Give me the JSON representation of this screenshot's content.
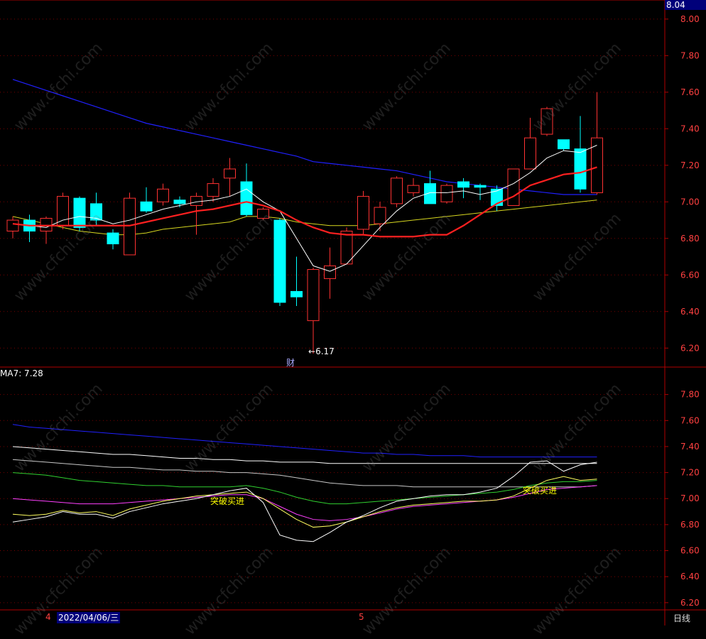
{
  "chart_data": [
    {
      "type": "candlestick",
      "panel": "main",
      "ylim": [
        6.1,
        8.05
      ],
      "yticks": [
        "8.00",
        "7.80",
        "7.60",
        "7.40",
        "7.20",
        "7.00",
        "6.80",
        "6.60",
        "6.40",
        "6.20"
      ],
      "current_price_label": "8.04",
      "low_annotation": "6.17",
      "event_marker": "财",
      "colors": {
        "up": "#ff3232",
        "down": "#00ffff",
        "ma_white": "#ffffff",
        "ma_red": "#ff2020",
        "ma_yellow": "#d8d820",
        "ma_blue": "#2020ff"
      },
      "candles": [
        {
          "o": 6.84,
          "h": 6.92,
          "l": 6.8,
          "c": 6.9
        },
        {
          "o": 6.9,
          "h": 6.93,
          "l": 6.78,
          "c": 6.84
        },
        {
          "o": 6.84,
          "h": 6.92,
          "l": 6.77,
          "c": 6.91
        },
        {
          "o": 6.87,
          "h": 7.05,
          "l": 6.85,
          "c": 7.03
        },
        {
          "o": 7.02,
          "h": 7.03,
          "l": 6.84,
          "c": 6.86
        },
        {
          "o": 6.99,
          "h": 7.05,
          "l": 6.87,
          "c": 6.9
        },
        {
          "o": 6.83,
          "h": 6.85,
          "l": 6.74,
          "c": 6.77
        },
        {
          "o": 6.71,
          "h": 7.05,
          "l": 6.71,
          "c": 7.02
        },
        {
          "o": 7.0,
          "h": 7.08,
          "l": 6.94,
          "c": 6.95
        },
        {
          "o": 7.0,
          "h": 7.1,
          "l": 6.98,
          "c": 7.07
        },
        {
          "o": 7.01,
          "h": 7.03,
          "l": 6.97,
          "c": 6.99
        },
        {
          "o": 6.98,
          "h": 7.05,
          "l": 6.82,
          "c": 7.03
        },
        {
          "o": 7.03,
          "h": 7.13,
          "l": 7.0,
          "c": 7.1
        },
        {
          "o": 7.13,
          "h": 7.24,
          "l": 7.03,
          "c": 7.18
        },
        {
          "o": 7.11,
          "h": 7.21,
          "l": 6.92,
          "c": 6.93
        },
        {
          "o": 6.91,
          "h": 6.97,
          "l": 6.9,
          "c": 6.96
        },
        {
          "o": 6.9,
          "h": 6.91,
          "l": 6.43,
          "c": 6.45
        },
        {
          "o": 6.51,
          "h": 6.7,
          "l": 6.43,
          "c": 6.48
        },
        {
          "o": 6.35,
          "h": 6.64,
          "l": 6.17,
          "c": 6.63
        },
        {
          "o": 6.58,
          "h": 6.75,
          "l": 6.47,
          "c": 6.65
        },
        {
          "o": 6.66,
          "h": 6.86,
          "l": 6.66,
          "c": 6.84
        },
        {
          "o": 6.85,
          "h": 7.06,
          "l": 6.82,
          "c": 7.03
        },
        {
          "o": 6.88,
          "h": 7.0,
          "l": 6.84,
          "c": 6.97
        },
        {
          "o": 6.99,
          "h": 7.14,
          "l": 6.97,
          "c": 7.13
        },
        {
          "o": 7.05,
          "h": 7.13,
          "l": 7.03,
          "c": 7.09
        },
        {
          "o": 7.1,
          "h": 7.17,
          "l": 6.99,
          "c": 6.99
        },
        {
          "o": 7.0,
          "h": 7.1,
          "l": 6.99,
          "c": 7.09
        },
        {
          "o": 7.11,
          "h": 7.13,
          "l": 7.02,
          "c": 7.08
        },
        {
          "o": 7.09,
          "h": 7.1,
          "l": 7.01,
          "c": 7.08
        },
        {
          "o": 7.07,
          "h": 7.09,
          "l": 6.95,
          "c": 6.98
        },
        {
          "o": 6.98,
          "h": 7.18,
          "l": 6.98,
          "c": 7.18
        },
        {
          "o": 7.18,
          "h": 7.46,
          "l": 7.18,
          "c": 7.35
        },
        {
          "o": 7.37,
          "h": 7.52,
          "l": 7.36,
          "c": 7.51
        },
        {
          "o": 7.34,
          "h": 7.34,
          "l": 7.28,
          "c": 7.29
        },
        {
          "o": 7.29,
          "h": 7.47,
          "l": 7.05,
          "c": 7.07
        },
        {
          "o": 7.05,
          "h": 7.6,
          "l": 7.04,
          "c": 7.35
        }
      ],
      "ma_white": [
        6.88,
        6.87,
        6.86,
        6.9,
        6.92,
        6.91,
        6.88,
        6.9,
        6.93,
        6.96,
        6.98,
        7.0,
        7.01,
        7.03,
        7.07,
        7.0,
        6.95,
        6.8,
        6.65,
        6.62,
        6.66,
        6.76,
        6.86,
        6.95,
        7.02,
        7.05,
        7.05,
        7.06,
        7.04,
        7.06,
        7.1,
        7.16,
        7.24,
        7.28,
        7.27,
        7.31
      ],
      "ma_red": [
        6.88,
        6.87,
        6.87,
        6.87,
        6.87,
        6.87,
        6.87,
        6.87,
        6.89,
        6.91,
        6.93,
        6.95,
        6.96,
        6.98,
        7.0,
        6.98,
        6.95,
        6.9,
        6.86,
        6.83,
        6.82,
        6.82,
        6.81,
        6.81,
        6.81,
        6.82,
        6.82,
        6.87,
        6.93,
        6.99,
        7.03,
        7.09,
        7.12,
        7.15,
        7.16,
        7.19
      ],
      "ma_yellow": [
        6.92,
        6.9,
        6.88,
        6.86,
        6.84,
        6.83,
        6.82,
        6.82,
        6.83,
        6.85,
        6.86,
        6.87,
        6.88,
        6.89,
        6.92,
        6.92,
        6.91,
        6.89,
        6.88,
        6.87,
        6.87,
        6.87,
        6.88,
        6.89,
        6.9,
        6.91,
        6.92,
        6.93,
        6.94,
        6.95,
        6.96,
        6.97,
        6.98,
        6.99,
        7.0,
        7.01
      ],
      "ma_blue": [
        7.67,
        7.64,
        7.61,
        7.58,
        7.55,
        7.52,
        7.49,
        7.46,
        7.43,
        7.41,
        7.39,
        7.37,
        7.35,
        7.33,
        7.31,
        7.29,
        7.27,
        7.25,
        7.22,
        7.21,
        7.2,
        7.19,
        7.18,
        7.17,
        7.15,
        7.13,
        7.11,
        7.1,
        7.09,
        7.08,
        7.07,
        7.06,
        7.05,
        7.04,
        7.04,
        7.04
      ]
    },
    {
      "type": "line",
      "panel": "indicator",
      "readout": "MA7: 7.28",
      "ylim": [
        6.15,
        8.0
      ],
      "yticks": [
        "7.80",
        "7.60",
        "7.40",
        "7.20",
        "7.00",
        "6.80",
        "6.60",
        "6.40",
        "6.20"
      ],
      "signal_label": "突破买进",
      "signal_points": [
        14,
        32
      ],
      "series": [
        {
          "color": "#2020ff",
          "values": [
            7.57,
            7.55,
            7.54,
            7.53,
            7.52,
            7.51,
            7.5,
            7.49,
            7.48,
            7.47,
            7.46,
            7.45,
            7.44,
            7.43,
            7.42,
            7.41,
            7.4,
            7.39,
            7.38,
            7.37,
            7.36,
            7.35,
            7.35,
            7.34,
            7.34,
            7.33,
            7.33,
            7.33,
            7.32,
            7.32,
            7.32,
            7.32,
            7.32,
            7.32,
            7.32,
            7.32
          ]
        },
        {
          "color": "#ffffff",
          "values": [
            7.4,
            7.39,
            7.38,
            7.37,
            7.36,
            7.35,
            7.34,
            7.34,
            7.33,
            7.32,
            7.31,
            7.31,
            7.3,
            7.3,
            7.29,
            7.29,
            7.28,
            7.28,
            7.28,
            7.27,
            7.27,
            7.27,
            7.27,
            7.27,
            7.27,
            7.27,
            7.27,
            7.27,
            7.27,
            7.27,
            7.27,
            7.27,
            7.27,
            7.27,
            7.27,
            7.27
          ]
        },
        {
          "color": "#c8c8c8",
          "values": [
            7.3,
            7.29,
            7.28,
            7.27,
            7.26,
            7.25,
            7.24,
            7.24,
            7.23,
            7.22,
            7.22,
            7.21,
            7.21,
            7.2,
            7.2,
            7.19,
            7.18,
            7.16,
            7.14,
            7.12,
            7.11,
            7.1,
            7.1,
            7.1,
            7.09,
            7.09,
            7.09,
            7.09,
            7.09,
            7.09,
            7.09,
            7.09,
            7.09,
            7.09,
            7.09,
            7.1
          ]
        },
        {
          "color": "#30d030",
          "values": [
            7.2,
            7.19,
            7.18,
            7.16,
            7.14,
            7.13,
            7.12,
            7.11,
            7.1,
            7.1,
            7.09,
            7.09,
            7.09,
            7.09,
            7.1,
            7.08,
            7.05,
            7.01,
            6.98,
            6.96,
            6.96,
            6.97,
            6.98,
            6.99,
            7.0,
            7.01,
            7.02,
            7.03,
            7.04,
            7.05,
            7.07,
            7.1,
            7.12,
            7.13,
            7.13,
            7.14
          ]
        },
        {
          "color": "#ff40ff",
          "values": [
            7.0,
            6.99,
            6.98,
            6.97,
            6.96,
            6.96,
            6.96,
            6.97,
            6.98,
            6.99,
            7.0,
            7.01,
            7.02,
            7.03,
            7.03,
            7.0,
            6.94,
            6.88,
            6.84,
            6.83,
            6.84,
            6.86,
            6.89,
            6.92,
            6.94,
            6.95,
            6.96,
            6.97,
            6.98,
            6.99,
            7.01,
            7.04,
            7.07,
            7.08,
            7.09,
            7.1
          ]
        },
        {
          "color": "#ffff60",
          "values": [
            6.88,
            6.87,
            6.88,
            6.91,
            6.89,
            6.9,
            6.87,
            6.92,
            6.95,
            6.98,
            7.0,
            7.02,
            7.03,
            7.04,
            7.05,
            7.0,
            6.92,
            6.84,
            6.78,
            6.79,
            6.82,
            6.86,
            6.9,
            6.93,
            6.95,
            6.96,
            6.97,
            6.98,
            6.98,
            6.99,
            7.02,
            7.08,
            7.14,
            7.17,
            7.14,
            7.15
          ]
        },
        {
          "color": "#ffffff",
          "values": [
            6.82,
            6.84,
            6.86,
            6.9,
            6.88,
            6.88,
            6.85,
            6.9,
            6.93,
            6.96,
            6.98,
            7.0,
            7.03,
            7.06,
            7.08,
            6.97,
            6.72,
            6.68,
            6.67,
            6.74,
            6.82,
            6.87,
            6.93,
            6.98,
            7.0,
            7.02,
            7.03,
            7.03,
            7.05,
            7.08,
            7.17,
            7.28,
            7.29,
            7.21,
            7.26,
            7.28
          ]
        }
      ]
    }
  ],
  "bottom_bar": {
    "month_left": "4",
    "cursor_date": "2022/04/06/三",
    "month_mid": "5",
    "period": "日线"
  },
  "watermark_text": "www.cfchi.com"
}
